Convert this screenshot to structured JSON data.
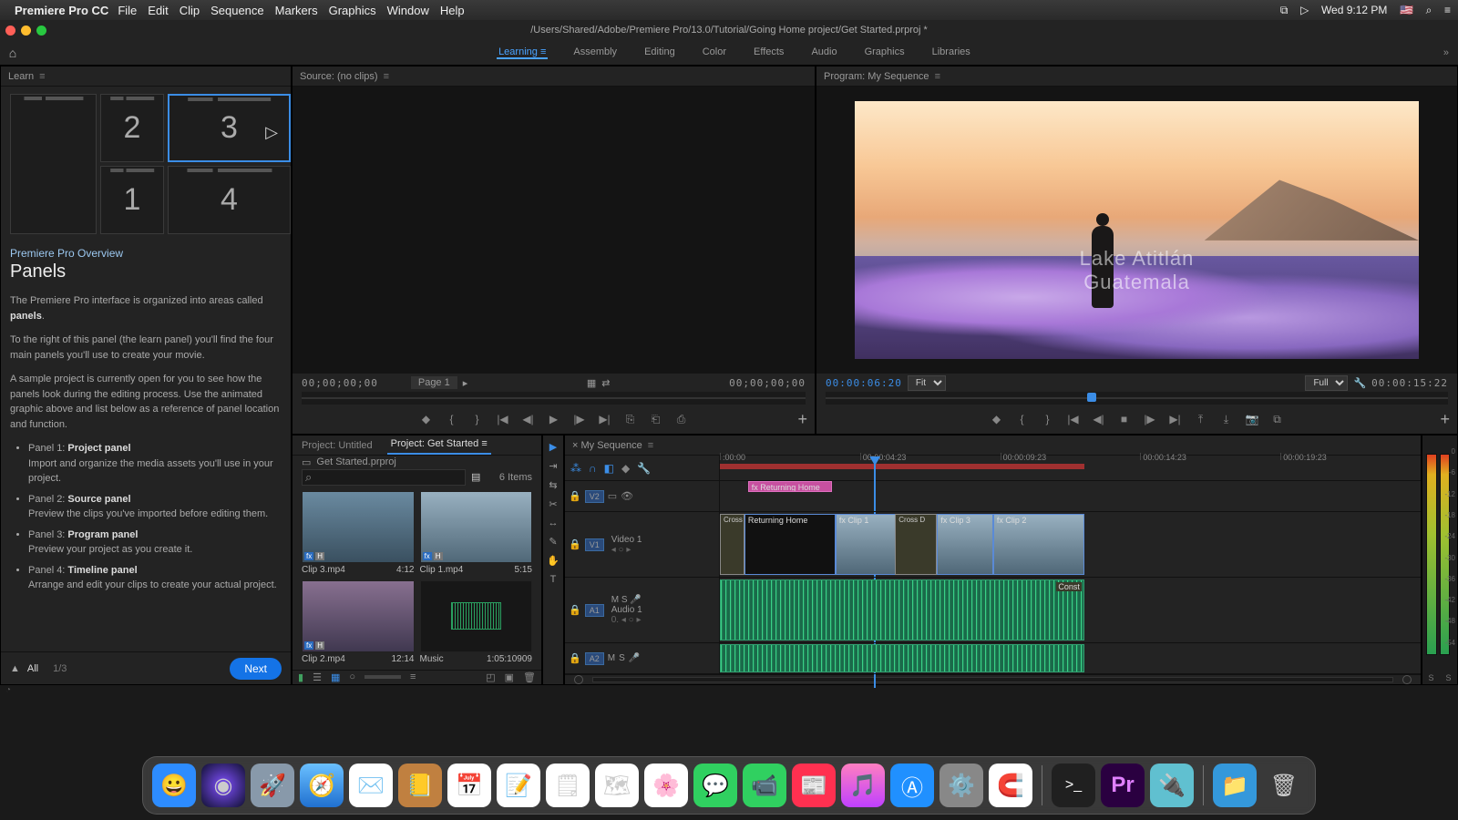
{
  "menubar": {
    "app": "Premiere Pro CC",
    "items": [
      "File",
      "Edit",
      "Clip",
      "Sequence",
      "Markers",
      "Graphics",
      "Window",
      "Help"
    ],
    "clock": "Wed 9:12 PM"
  },
  "titlebar": {
    "path": "/Users/Shared/Adobe/Premiere Pro/13.0/Tutorial/Going Home project/Get Started.prproj *"
  },
  "workspaces": {
    "items": [
      "Learning",
      "Assembly",
      "Editing",
      "Color",
      "Effects",
      "Audio",
      "Graphics",
      "Libraries"
    ],
    "active": 0
  },
  "learn": {
    "tab": "Learn",
    "overline": "Premiere Pro Overview",
    "title": "Panels",
    "p1": "The Premiere Pro interface is organized into areas called ",
    "p1b": "panels",
    "p2": "To the right of this panel (the learn panel) you'll find the four main panels you'll use to create your movie.",
    "p3": "A sample project is currently open for you to see how the panels look during the editing process. Use the animated graphic above and list below as a reference of panel location and function.",
    "b1": {
      "pre": "Panel 1: ",
      "name": "Project panel",
      "desc": "Import and organize the media assets you'll use in your project."
    },
    "b2": {
      "pre": "Panel 2: ",
      "name": "Source panel",
      "desc": "Preview the clips you've imported before editing them."
    },
    "b3": {
      "pre": "Panel 3: ",
      "name": "Program panel",
      "desc": "Preview your project as you create it."
    },
    "b4": {
      "pre": "Panel 4: ",
      "name": "Timeline panel",
      "desc": "Arrange and edit your clips to create your actual project."
    },
    "all": "All",
    "page": "1/3",
    "next": "Next",
    "thumbs": [
      "",
      "2",
      "3",
      "1",
      "4"
    ]
  },
  "source": {
    "tab": "Source: (no clips)",
    "tc_left": "00;00;00;00",
    "page": "Page 1",
    "tc_right": "00;00;00;00"
  },
  "program": {
    "tab": "Program: My Sequence",
    "tc_left": "00:00:06:20",
    "fit": "Fit",
    "zoom": "Full",
    "tc_right": "00:00:15:22",
    "watermark": "Lake Atitlán\nGuatemala"
  },
  "project": {
    "tabs": [
      "Project: Untitled",
      "Project: Get Started"
    ],
    "active": 1,
    "file": "Get Started.prproj",
    "items_count": "6 Items",
    "bins": [
      {
        "name": "Clip 3.mp4",
        "dur": "4:12",
        "kind": "dock"
      },
      {
        "name": "Clip 1.mp4",
        "dur": "5:15",
        "kind": "lake"
      },
      {
        "name": "Clip 2.mp4",
        "dur": "12:14",
        "kind": "person"
      },
      {
        "name": "Music",
        "dur": "1:05:10909",
        "kind": "audio"
      }
    ]
  },
  "timeline": {
    "tab": "My Sequence",
    "tc": "00:00:06:20",
    "ticks": [
      ":00:00",
      "00:00:04:23",
      "00:00:09:23",
      "00:00:14:23",
      "00:00:19:23"
    ],
    "playhead_pct": 22,
    "tracks": {
      "v2": "V2",
      "v1": "V1",
      "a1": "A1",
      "a2": "A2",
      "video1": "Video 1",
      "audio1": "Audio 1"
    },
    "clips": {
      "title": "Returning Home",
      "v_labels": [
        "Cross",
        "Returning Home",
        "Clip 1",
        "Cross D",
        "Clip 3",
        "Clip 2"
      ],
      "const": "Const"
    }
  },
  "meters": {
    "ticks": [
      "0",
      "-6",
      "-12",
      "-18",
      "-24",
      "-30",
      "-36",
      "-42",
      "-48",
      "-54"
    ],
    "labels": [
      "S",
      "S"
    ]
  },
  "dock": [
    {
      "c": "#2d8cff",
      "g": "😀"
    },
    {
      "c": "#303040",
      "g": "🔮"
    },
    {
      "c": "#8899aa",
      "g": "🚀"
    },
    {
      "c": "#3a8ff0",
      "g": "🧭"
    },
    {
      "c": "#d8a050",
      "g": "✉️"
    },
    {
      "c": "#c08040",
      "g": "📒"
    },
    {
      "c": "#ff5a40",
      "g": "📅"
    },
    {
      "c": "#fff",
      "g": "📝"
    },
    {
      "c": "#fff",
      "g": "🗒"
    },
    {
      "c": "#fff",
      "g": "🗺"
    },
    {
      "c": "#fff",
      "g": "🌸"
    },
    {
      "c": "#30a0ff",
      "g": "💬"
    },
    {
      "c": "#30d060",
      "g": "📞"
    },
    {
      "c": "#ff3050",
      "g": "📰"
    },
    {
      "c": "#ff5fa0",
      "g": "🎵"
    },
    {
      "c": "#2090ff",
      "g": "A"
    },
    {
      "c": "#888",
      "g": "⚙️"
    },
    {
      "c": "#fff",
      "g": "🧲"
    }
  ],
  "dock_right": [
    {
      "c": "#202020",
      "g": ">_"
    },
    {
      "c": "#2a0040",
      "g": "Pr"
    },
    {
      "c": "#60c0d0",
      "g": "🔌"
    },
    {
      "c": "#3498db",
      "g": "📁"
    },
    {
      "c": "#555",
      "g": "🗑"
    }
  ]
}
